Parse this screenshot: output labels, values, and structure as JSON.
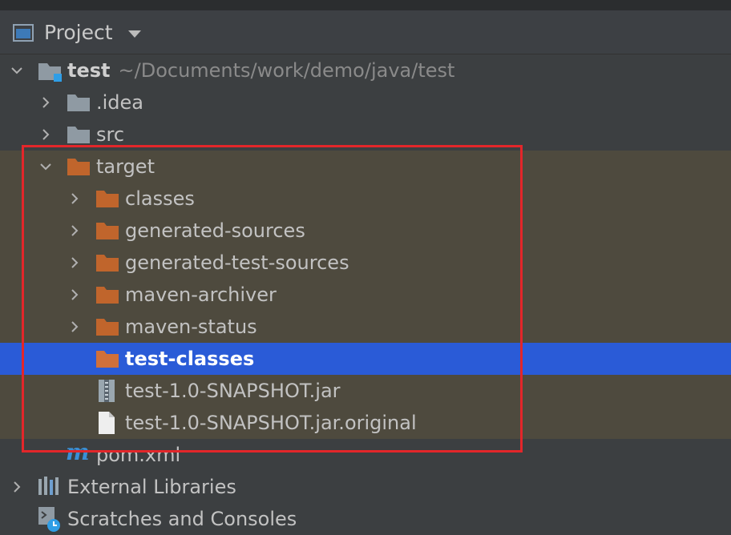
{
  "header": {
    "title": "Project",
    "icon": "window-icon",
    "dropdown_icon": "caret-down-icon"
  },
  "tree": {
    "root": {
      "name": "test",
      "path": "~/Documents/work/demo/java/test"
    },
    "idea": "idea",
    "idea_label": ".idea",
    "src": "src",
    "target": "target",
    "target_children": {
      "classes": "classes",
      "generated_sources": "generated-sources",
      "generated_test_sources": "generated-test-sources",
      "maven_archiver": "maven-archiver",
      "maven_status": "maven-status",
      "test_classes": "test-classes",
      "jar": "test-1.0-SNAPSHOT.jar",
      "jar_original": "test-1.0-SNAPSHOT.jar.original"
    },
    "pom": "pom.xml",
    "external_libraries": "External Libraries",
    "scratches": "Scratches and Consoles"
  },
  "colors": {
    "panel_bg": "#3c3f41",
    "selection": "#2a5bd7",
    "highlight_row": "#4e4a3e",
    "excluded_folder": "#c0652c",
    "folder": "#8f9aa3",
    "annotation_box": "#e3262a"
  }
}
